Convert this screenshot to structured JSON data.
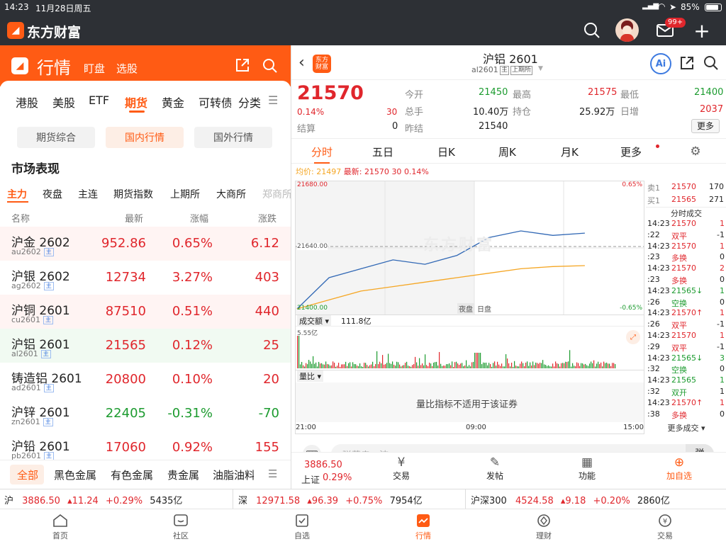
{
  "status_bar": {
    "time": "14:23",
    "date": "11月28日周五",
    "battery": "85%"
  },
  "app": {
    "name": "东方财富",
    "badge": "99+"
  },
  "left": {
    "title": "行情",
    "sub_tabs": [
      "盯盘",
      "选股"
    ],
    "market_tabs": [
      "港股",
      "美股",
      "ETF",
      "期货",
      "黄金",
      "可转债",
      "分类"
    ],
    "active_market_tab": "期货",
    "segments": [
      "期货综合",
      "国内行情",
      "国外行情"
    ],
    "active_segment": "国内行情",
    "section_title": "市场表现",
    "filter_tabs": [
      "主力",
      "夜盘",
      "主连",
      "期货指数",
      "上期所",
      "大商所",
      "郑商所"
    ],
    "active_filter": "主力",
    "columns": {
      "name": "名称",
      "latest": "最新",
      "change_pct": "涨幅",
      "change": "涨跌"
    },
    "rows": [
      {
        "name": "沪金 2602",
        "code": "au2602",
        "tag": "主",
        "latest": "952.86",
        "pct": "0.65%",
        "chg": "6.12",
        "dir": "up"
      },
      {
        "name": "沪银 2602",
        "code": "ag2602",
        "tag": "主",
        "latest": "12734",
        "pct": "3.27%",
        "chg": "403",
        "dir": "up"
      },
      {
        "name": "沪铜 2601",
        "code": "cu2601",
        "tag": "主",
        "latest": "87510",
        "pct": "0.51%",
        "chg": "440",
        "dir": "up"
      },
      {
        "name": "沪铝 2601",
        "code": "al2601",
        "tag": "主",
        "latest": "21565",
        "pct": "0.12%",
        "chg": "25",
        "dir": "up"
      },
      {
        "name": "铸造铝 2601",
        "code": "ad2601",
        "tag": "主",
        "latest": "20800",
        "pct": "0.10%",
        "chg": "20",
        "dir": "up"
      },
      {
        "name": "沪锌 2601",
        "code": "zn2601",
        "tag": "主",
        "latest": "22405",
        "pct": "-0.31%",
        "chg": "-70",
        "dir": "down"
      },
      {
        "name": "沪铅 2601",
        "code": "pb2601",
        "tag": "主",
        "latest": "17060",
        "pct": "0.92%",
        "chg": "155",
        "dir": "up"
      }
    ],
    "category_tabs": [
      "全部",
      "黑色金属",
      "有色金属",
      "贵金属",
      "油脂油料"
    ],
    "active_category": "全部"
  },
  "right": {
    "title": "沪铝 2601",
    "code": "al2601",
    "tags": [
      "主",
      "上期所"
    ],
    "price": "21570",
    "pct": "0.14%",
    "chg": "30",
    "stats": [
      {
        "label": "今开",
        "value": "21450",
        "color": "green"
      },
      {
        "label": "最高",
        "value": "21575",
        "color": "red"
      },
      {
        "label": "最低",
        "value": "21400",
        "color": "green"
      },
      {
        "label": "总手",
        "value": "10.40万",
        "color": "dark"
      },
      {
        "label": "持仓",
        "value": "25.92万",
        "color": "dark"
      },
      {
        "label": "日增",
        "value": "2037",
        "color": "red"
      },
      {
        "label": "结算",
        "value": "0",
        "color": "dark"
      },
      {
        "label": "昨结",
        "value": "21540",
        "color": "dark"
      }
    ],
    "more_label": "更多",
    "chart_tabs": [
      "分时",
      "五日",
      "日K",
      "周K",
      "月K",
      "更多"
    ],
    "active_chart_tab": "分时",
    "avg_line": {
      "avg_label": "均价:",
      "avg_value": "21497",
      "latest_label": "最新:",
      "latest_value": "21570",
      "chg": "30",
      "pct": "0.14%"
    },
    "order_book": [
      {
        "label": "卖1",
        "price": "21570",
        "vol": "170"
      },
      {
        "label": "买1",
        "price": "21565",
        "vol": "271"
      }
    ],
    "ticks_title": "分时成交",
    "ticks": [
      {
        "time": "14:23",
        "price": "21570",
        "arrow": "",
        "vol": "1",
        "pc": "red",
        "vc": "red"
      },
      {
        "time": ":22",
        "price": "双平",
        "arrow": "",
        "vol": "-1",
        "pc": "red",
        "vc": "dark"
      },
      {
        "time": "14:23",
        "price": "21570",
        "arrow": "",
        "vol": "1",
        "pc": "red",
        "vc": "red"
      },
      {
        "time": ":23",
        "price": "多换",
        "arrow": "",
        "vol": "0",
        "pc": "red",
        "vc": "dark"
      },
      {
        "time": "14:23",
        "price": "21570",
        "arrow": "",
        "vol": "2",
        "pc": "red",
        "vc": "red"
      },
      {
        "time": ":23",
        "price": "多换",
        "arrow": "",
        "vol": "0",
        "pc": "red",
        "vc": "dark"
      },
      {
        "time": "14:23",
        "price": "21565",
        "arrow": "↓",
        "vol": "1",
        "pc": "green",
        "vc": "green"
      },
      {
        "time": ":26",
        "price": "空换",
        "arrow": "",
        "vol": "0",
        "pc": "green",
        "vc": "dark"
      },
      {
        "time": "14:23",
        "price": "21570",
        "arrow": "↑",
        "vol": "1",
        "pc": "red",
        "vc": "red"
      },
      {
        "time": ":26",
        "price": "双平",
        "arrow": "",
        "vol": "-1",
        "pc": "red",
        "vc": "dark"
      },
      {
        "time": "14:23",
        "price": "21570",
        "arrow": "",
        "vol": "1",
        "pc": "red",
        "vc": "red"
      },
      {
        "time": ":29",
        "price": "双平",
        "arrow": "",
        "vol": "-1",
        "pc": "red",
        "vc": "dark"
      },
      {
        "time": "14:23",
        "price": "21565",
        "arrow": "↓",
        "vol": "3",
        "pc": "green",
        "vc": "green"
      },
      {
        "time": ":32",
        "price": "空换",
        "arrow": "",
        "vol": "0",
        "pc": "green",
        "vc": "dark"
      },
      {
        "time": "14:23",
        "price": "21565",
        "arrow": "",
        "vol": "1",
        "pc": "green",
        "vc": "green"
      },
      {
        "time": ":32",
        "price": "双开",
        "arrow": "",
        "vol": "1",
        "pc": "green",
        "vc": "dark"
      },
      {
        "time": "14:23",
        "price": "21570",
        "arrow": "↑",
        "vol": "1",
        "pc": "red",
        "vc": "red"
      },
      {
        "time": ":38",
        "price": "多换",
        "arrow": "",
        "vol": "0",
        "pc": "red",
        "vc": "dark"
      }
    ],
    "more_ticks": "更多成交",
    "chart": {
      "upper_price": "21680.00",
      "mid_price": "21640.00",
      "lower_price": "21400.00",
      "upper_pct": "0.65%",
      "lower_pct": "-0.65%",
      "session_night": "夜盘",
      "session_day": "日盘",
      "watermark": "东方财富",
      "volume_label": "成交额",
      "volume_value": "111.8亿",
      "volume_max": "5.55亿",
      "ratio_label": "量比",
      "ratio_message": "量比指标不适用于该证券",
      "x_labels": [
        "21:00",
        "09:00",
        "15:00"
      ]
    },
    "comment_placeholder": "弹幕走一波",
    "comment_button": "弹",
    "action_bar": {
      "index_value": "3886.50",
      "index_name": "上证",
      "index_pct": "0.29%",
      "items": [
        "交易",
        "发帖",
        "功能",
        "加自选"
      ]
    }
  },
  "ticker_strip": [
    {
      "name": "沪",
      "value": "3886.50",
      "chg": "11.24",
      "pct": "+0.29%",
      "amount": "5435亿"
    },
    {
      "name": "深",
      "value": "12971.58",
      "chg": "96.39",
      "pct": "+0.75%",
      "amount": "7954亿"
    },
    {
      "name": "沪深300",
      "value": "4524.58",
      "chg": "9.18",
      "pct": "+0.20%",
      "amount": "2860亿"
    }
  ],
  "bottom_nav": [
    {
      "label": "首页",
      "icon": "home-icon"
    },
    {
      "label": "社区",
      "icon": "community-icon"
    },
    {
      "label": "自选",
      "icon": "watchlist-icon"
    },
    {
      "label": "行情",
      "icon": "market-icon"
    },
    {
      "label": "理财",
      "icon": "finance-icon"
    },
    {
      "label": "交易",
      "icon": "trade-icon"
    }
  ],
  "active_nav": "行情",
  "chart_data": {
    "type": "line",
    "title": "",
    "xlabel": "",
    "ylabel": "",
    "x": [
      "21:00",
      "22:00",
      "23:00",
      "00:00",
      "01:00",
      "09:00",
      "10:00",
      "11:00",
      "13:30",
      "14:23",
      "15:00"
    ],
    "series": [
      {
        "values": [
          21400,
          21470,
          21490,
          21510,
          21500,
          21520,
          21560,
          21575,
          21565,
          21570,
          null
        ]
      },
      {
        "values": [
          21400,
          21420,
          21440,
          21450,
          21460,
          21470,
          21480,
          21490,
          21495,
          21497,
          null
        ]
      }
    ],
    "ylim": [
      21400,
      21680
    ],
    "reference_line": 21540,
    "grid": true
  },
  "colors": {
    "brand_orange": "#ff5b14",
    "up_red": "#e0262c",
    "down_green": "#1c9b2f",
    "price_line": "#3168b5",
    "avg_line": "#f5a623"
  }
}
